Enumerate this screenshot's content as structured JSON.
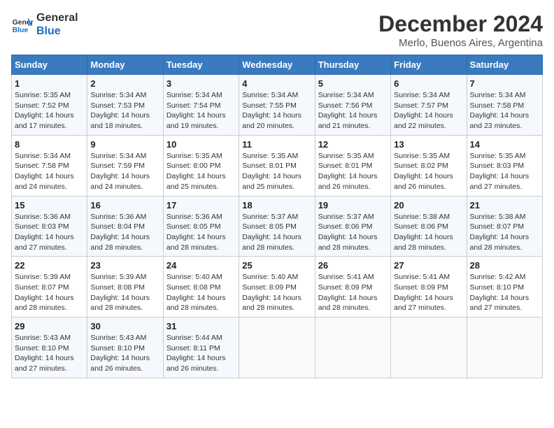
{
  "header": {
    "logo_line1": "General",
    "logo_line2": "Blue",
    "title": "December 2024",
    "subtitle": "Merlo, Buenos Aires, Argentina"
  },
  "weekdays": [
    "Sunday",
    "Monday",
    "Tuesday",
    "Wednesday",
    "Thursday",
    "Friday",
    "Saturday"
  ],
  "weeks": [
    [
      {
        "day": "1",
        "sunrise": "Sunrise: 5:35 AM",
        "sunset": "Sunset: 7:52 PM",
        "daylight": "Daylight: 14 hours and 17 minutes."
      },
      {
        "day": "2",
        "sunrise": "Sunrise: 5:34 AM",
        "sunset": "Sunset: 7:53 PM",
        "daylight": "Daylight: 14 hours and 18 minutes."
      },
      {
        "day": "3",
        "sunrise": "Sunrise: 5:34 AM",
        "sunset": "Sunset: 7:54 PM",
        "daylight": "Daylight: 14 hours and 19 minutes."
      },
      {
        "day": "4",
        "sunrise": "Sunrise: 5:34 AM",
        "sunset": "Sunset: 7:55 PM",
        "daylight": "Daylight: 14 hours and 20 minutes."
      },
      {
        "day": "5",
        "sunrise": "Sunrise: 5:34 AM",
        "sunset": "Sunset: 7:56 PM",
        "daylight": "Daylight: 14 hours and 21 minutes."
      },
      {
        "day": "6",
        "sunrise": "Sunrise: 5:34 AM",
        "sunset": "Sunset: 7:57 PM",
        "daylight": "Daylight: 14 hours and 22 minutes."
      },
      {
        "day": "7",
        "sunrise": "Sunrise: 5:34 AM",
        "sunset": "Sunset: 7:58 PM",
        "daylight": "Daylight: 14 hours and 23 minutes."
      }
    ],
    [
      {
        "day": "8",
        "sunrise": "Sunrise: 5:34 AM",
        "sunset": "Sunset: 7:58 PM",
        "daylight": "Daylight: 14 hours and 24 minutes."
      },
      {
        "day": "9",
        "sunrise": "Sunrise: 5:34 AM",
        "sunset": "Sunset: 7:59 PM",
        "daylight": "Daylight: 14 hours and 24 minutes."
      },
      {
        "day": "10",
        "sunrise": "Sunrise: 5:35 AM",
        "sunset": "Sunset: 8:00 PM",
        "daylight": "Daylight: 14 hours and 25 minutes."
      },
      {
        "day": "11",
        "sunrise": "Sunrise: 5:35 AM",
        "sunset": "Sunset: 8:01 PM",
        "daylight": "Daylight: 14 hours and 25 minutes."
      },
      {
        "day": "12",
        "sunrise": "Sunrise: 5:35 AM",
        "sunset": "Sunset: 8:01 PM",
        "daylight": "Daylight: 14 hours and 26 minutes."
      },
      {
        "day": "13",
        "sunrise": "Sunrise: 5:35 AM",
        "sunset": "Sunset: 8:02 PM",
        "daylight": "Daylight: 14 hours and 26 minutes."
      },
      {
        "day": "14",
        "sunrise": "Sunrise: 5:35 AM",
        "sunset": "Sunset: 8:03 PM",
        "daylight": "Daylight: 14 hours and 27 minutes."
      }
    ],
    [
      {
        "day": "15",
        "sunrise": "Sunrise: 5:36 AM",
        "sunset": "Sunset: 8:03 PM",
        "daylight": "Daylight: 14 hours and 27 minutes."
      },
      {
        "day": "16",
        "sunrise": "Sunrise: 5:36 AM",
        "sunset": "Sunset: 8:04 PM",
        "daylight": "Daylight: 14 hours and 28 minutes."
      },
      {
        "day": "17",
        "sunrise": "Sunrise: 5:36 AM",
        "sunset": "Sunset: 8:05 PM",
        "daylight": "Daylight: 14 hours and 28 minutes."
      },
      {
        "day": "18",
        "sunrise": "Sunrise: 5:37 AM",
        "sunset": "Sunset: 8:05 PM",
        "daylight": "Daylight: 14 hours and 28 minutes."
      },
      {
        "day": "19",
        "sunrise": "Sunrise: 5:37 AM",
        "sunset": "Sunset: 8:06 PM",
        "daylight": "Daylight: 14 hours and 28 minutes."
      },
      {
        "day": "20",
        "sunrise": "Sunrise: 5:38 AM",
        "sunset": "Sunset: 8:06 PM",
        "daylight": "Daylight: 14 hours and 28 minutes."
      },
      {
        "day": "21",
        "sunrise": "Sunrise: 5:38 AM",
        "sunset": "Sunset: 8:07 PM",
        "daylight": "Daylight: 14 hours and 28 minutes."
      }
    ],
    [
      {
        "day": "22",
        "sunrise": "Sunrise: 5:39 AM",
        "sunset": "Sunset: 8:07 PM",
        "daylight": "Daylight: 14 hours and 28 minutes."
      },
      {
        "day": "23",
        "sunrise": "Sunrise: 5:39 AM",
        "sunset": "Sunset: 8:08 PM",
        "daylight": "Daylight: 14 hours and 28 minutes."
      },
      {
        "day": "24",
        "sunrise": "Sunrise: 5:40 AM",
        "sunset": "Sunset: 8:08 PM",
        "daylight": "Daylight: 14 hours and 28 minutes."
      },
      {
        "day": "25",
        "sunrise": "Sunrise: 5:40 AM",
        "sunset": "Sunset: 8:09 PM",
        "daylight": "Daylight: 14 hours and 28 minutes."
      },
      {
        "day": "26",
        "sunrise": "Sunrise: 5:41 AM",
        "sunset": "Sunset: 8:09 PM",
        "daylight": "Daylight: 14 hours and 28 minutes."
      },
      {
        "day": "27",
        "sunrise": "Sunrise: 5:41 AM",
        "sunset": "Sunset: 8:09 PM",
        "daylight": "Daylight: 14 hours and 27 minutes."
      },
      {
        "day": "28",
        "sunrise": "Sunrise: 5:42 AM",
        "sunset": "Sunset: 8:10 PM",
        "daylight": "Daylight: 14 hours and 27 minutes."
      }
    ],
    [
      {
        "day": "29",
        "sunrise": "Sunrise: 5:43 AM",
        "sunset": "Sunset: 8:10 PM",
        "daylight": "Daylight: 14 hours and 27 minutes."
      },
      {
        "day": "30",
        "sunrise": "Sunrise: 5:43 AM",
        "sunset": "Sunset: 8:10 PM",
        "daylight": "Daylight: 14 hours and 26 minutes."
      },
      {
        "day": "31",
        "sunrise": "Sunrise: 5:44 AM",
        "sunset": "Sunset: 8:11 PM",
        "daylight": "Daylight: 14 hours and 26 minutes."
      },
      null,
      null,
      null,
      null
    ]
  ]
}
